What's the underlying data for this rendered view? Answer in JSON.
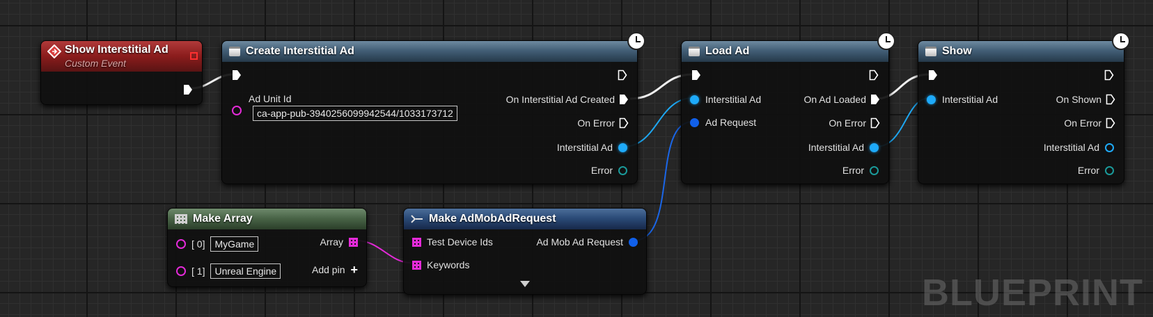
{
  "watermark": "BLUEPRINT",
  "colors": {
    "exec": "#ffffff",
    "object_pin": "#1eaafa",
    "struct_pin": "#1160ea",
    "string_pin": "#e42ad8",
    "event_header": "#8a1c1c"
  },
  "nodes": {
    "event": {
      "title": "Show Interstitial Ad",
      "subtitle": "Custom Event",
      "icon": "event-diamond-icon"
    },
    "create": {
      "title": "Create Interstitial Ad",
      "ad_unit_label": "Ad Unit Id",
      "ad_unit_value": "ca-app-pub-3940256099942544/1033173712",
      "out_created": "On Interstitial Ad Created",
      "out_error": "On Error",
      "out_ad": "Interstitial Ad",
      "out_error_obj": "Error"
    },
    "load": {
      "title": "Load Ad",
      "in_ad": "Interstitial Ad",
      "in_request": "Ad Request",
      "out_loaded": "On Ad Loaded",
      "out_error": "On Error",
      "out_ad": "Interstitial Ad",
      "out_error_obj": "Error"
    },
    "show": {
      "title": "Show",
      "in_ad": "Interstitial Ad",
      "out_shown": "On Shown",
      "out_error": "On Error",
      "out_ad": "Interstitial Ad",
      "out_error_obj": "Error"
    },
    "make_array": {
      "title": "Make Array",
      "items": [
        {
          "index": "[ 0]",
          "value": "MyGame"
        },
        {
          "index": "[ 1]",
          "value": "Unreal Engine"
        }
      ],
      "out_array": "Array",
      "add_pin": "Add pin"
    },
    "make_request": {
      "title": "Make AdMobAdRequest",
      "in_test_ids": "Test Device Ids",
      "in_keywords": "Keywords",
      "out_request": "Ad Mob Ad Request"
    }
  }
}
